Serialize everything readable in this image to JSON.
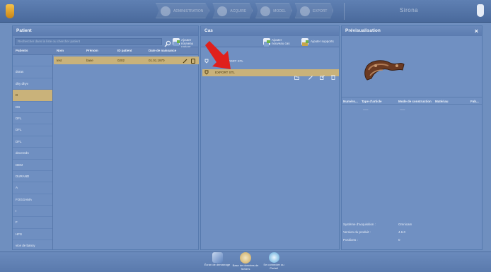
{
  "topbar": {
    "workflow_steps": [
      "ADMINISTRATION",
      "ACQUIRE",
      "MODEL",
      "EXPORT"
    ],
    "brand": "Sirona"
  },
  "patient": {
    "title": "Patient",
    "search_placeholder": "Rechercher dans la liste ou chercher patient",
    "add_patient_label": "Ajouter nouveau patient",
    "columns": [
      "Patients",
      "Nom",
      "Prénom",
      "ID patient",
      "Date de naissance"
    ],
    "selected_row": {
      "nom": "test",
      "prenom": "base",
      "id": "0202",
      "dob": "01.01.1970"
    },
    "list": [
      "",
      "doras",
      "dhy dhyv",
      "D",
      "DS",
      "DFL",
      "DFL",
      "DFL",
      "deceredn",
      "DEM",
      "DURAND",
      "A",
      "FOGGAMA",
      "I",
      "F",
      "HFS",
      "vice de bancy"
    ]
  },
  "cases": {
    "title": "Cas",
    "add_case_label": "Ajouter nouveau cas",
    "add_support_label": "Ajouter supports",
    "rows": [
      {
        "label": "EXPORT STL",
        "selected": false
      },
      {
        "label": "EXPORT STL",
        "selected": true
      }
    ]
  },
  "preview": {
    "title": "Prévisualisation",
    "close": "×",
    "columns": [
      "Numéro...",
      "Type d'article",
      "Mode de construction",
      "Matériau",
      "Fab..."
    ],
    "row": {
      "num": "",
      "type": "-----",
      "mode": "-----"
    },
    "info": [
      {
        "key": "Système d'acquisition :",
        "value": "Omnicam"
      },
      {
        "key": "Version du produit :",
        "value": "4.6.0"
      },
      {
        "key": "Positions :",
        "value": "0"
      }
    ]
  },
  "bottombar": {
    "items": [
      {
        "label": "Écran de démarrage"
      },
      {
        "label": "Base de données de fichiers"
      },
      {
        "label": "Se connecter au Portail"
      }
    ]
  },
  "colors": {
    "background": "#6f8fbf",
    "selection": "#c9b27a",
    "arrow": "#e0201c"
  }
}
